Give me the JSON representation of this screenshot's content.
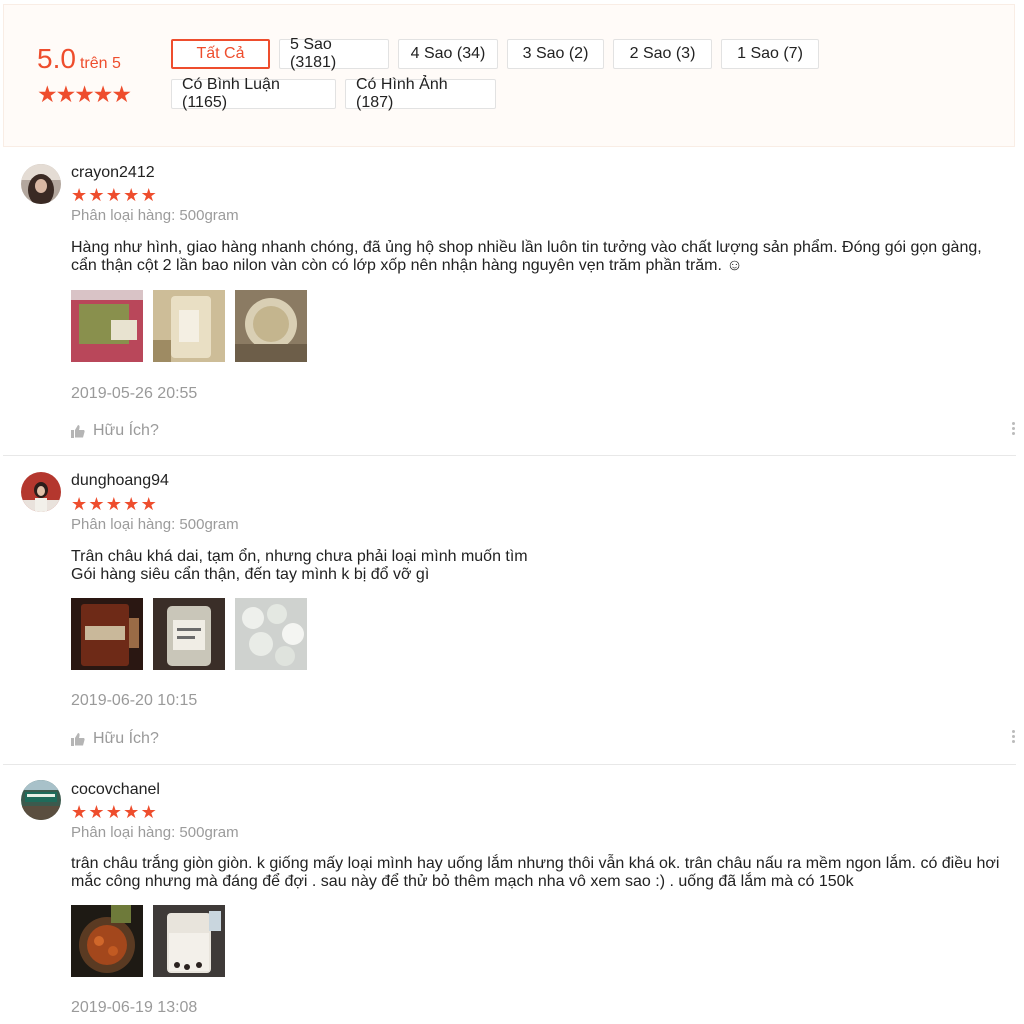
{
  "rating": {
    "score": "5.0",
    "out_of": "trên 5",
    "stars": 5
  },
  "filters": {
    "row1": [
      "Tất Cả",
      "5 Sao (3181)",
      "4 Sao (34)",
      "3 Sao (2)",
      "2 Sao (3)",
      "1 Sao (7)"
    ],
    "row2": [
      "Có Bình Luận (1165)",
      "Có Hình Ảnh (187)"
    ],
    "active": "Tất Cả"
  },
  "colors": {
    "accent": "#ee4d2d"
  },
  "reviews": [
    {
      "username": "crayon2412",
      "stars": 5,
      "variant": "Phân loại hàng: 500gram",
      "comment": "Hàng như hình, giao hàng nhanh chóng, đã ủng hộ shop nhiều lần luôn tin tưởng vào chất lượng sản phẩm. Đóng gói gọn gàng, cẩn thận cột 2 lần bao nilon vàn còn có lớp xốp nên nhận hàng nguyên vẹn trăm phần trăm. ☺",
      "date": "2019-05-26 20:55",
      "helpful": "Hữu Ích?",
      "photo_count": 3
    },
    {
      "username": "dunghoang94",
      "stars": 5,
      "variant": "Phân loại hàng: 500gram",
      "comment": "Trân châu khá dai, tạm ổn, nhưng chưa phải loại mình muốn tìm\nGói hàng siêu cẩn thận, đến tay mình k bị đổ vỡ gì",
      "date": "2019-06-20 10:15",
      "helpful": "Hữu Ích?",
      "photo_count": 3
    },
    {
      "username": "cocovchanel",
      "stars": 5,
      "variant": "Phân loại hàng: 500gram",
      "comment": "trân châu trắng giòn giòn. k giống mấy loại mình hay uống lắm nhưng thôi vẫn khá ok. trân châu nấu ra mềm ngon lắm. có điều hơi mắc công nhưng mà đáng để đợi . sau này để thử bỏ thêm mạch nha vô xem sao :) . uống đã lắm mà có 150k",
      "date": "2019-06-19 13:08",
      "photo_count": 2
    }
  ]
}
